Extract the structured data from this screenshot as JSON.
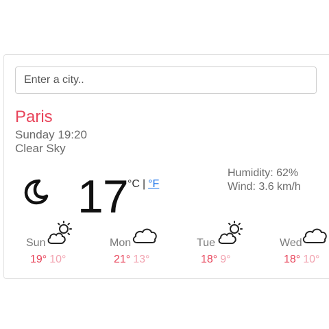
{
  "search": {
    "placeholder": "Enter a city.."
  },
  "location": {
    "city": "Paris",
    "datetime": "Sunday 19:20",
    "condition": "Clear Sky"
  },
  "current": {
    "temperature": "17",
    "icon": "moon-icon",
    "unit_celsius": "°C",
    "unit_separator": "|",
    "unit_fahrenheit": "°F",
    "humidity": "Humidity: 62%",
    "wind": "Wind: 3.6 km/h"
  },
  "forecast": [
    {
      "day": "Sun",
      "high": "19°",
      "low": "10°",
      "icon": "sun-cloud-icon"
    },
    {
      "day": "Mon",
      "high": "21°",
      "low": "13°",
      "icon": "cloud-icon"
    },
    {
      "day": "Tue",
      "high": "18°",
      "low": "9°",
      "icon": "sun-cloud-icon"
    },
    {
      "day": "Wed",
      "high": "18°",
      "low": "10°",
      "icon": "cloud-icon"
    }
  ],
  "colors": {
    "accent": "#e8445a",
    "low_temp": "#f2a3b0",
    "link": "#1a73e8"
  }
}
